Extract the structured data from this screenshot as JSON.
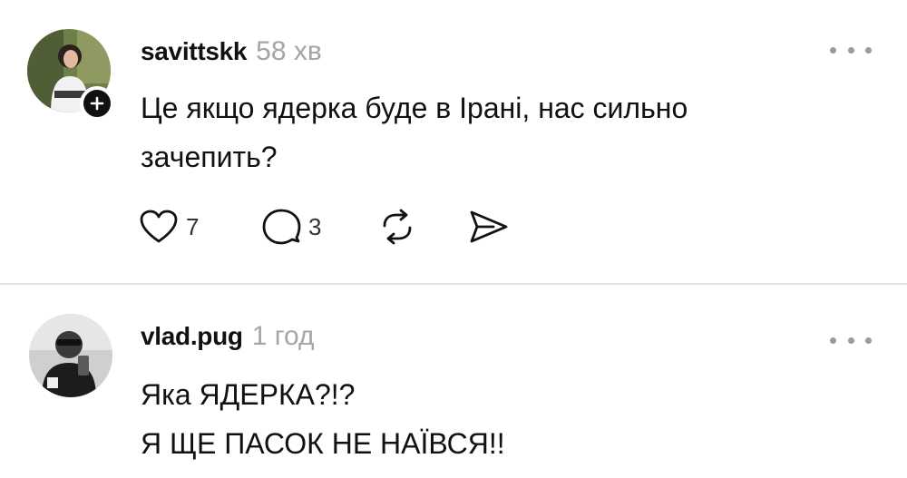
{
  "posts": [
    {
      "username": "savittskk",
      "time": "58 хв",
      "lines": [
        "Це якщо ядерка буде в Ірані, нас сильно",
        "зачепить?"
      ],
      "likes": "7",
      "replies": "3"
    },
    {
      "username": "vlad.pug",
      "time": "1 год",
      "lines": [
        "Яка ЯДЕРКА?!?",
        "Я ЩЕ ПАСОК НЕ НАЇВСЯ!!"
      ]
    }
  ],
  "icons": {
    "follow": "plus-icon",
    "more": "more-options-icon",
    "like": "heart-icon",
    "reply": "comment-icon",
    "repost": "repost-icon",
    "share": "send-icon"
  },
  "colors": {
    "text": "#111111",
    "muted": "#a5a5a5",
    "divider": "#e3e3e3"
  }
}
